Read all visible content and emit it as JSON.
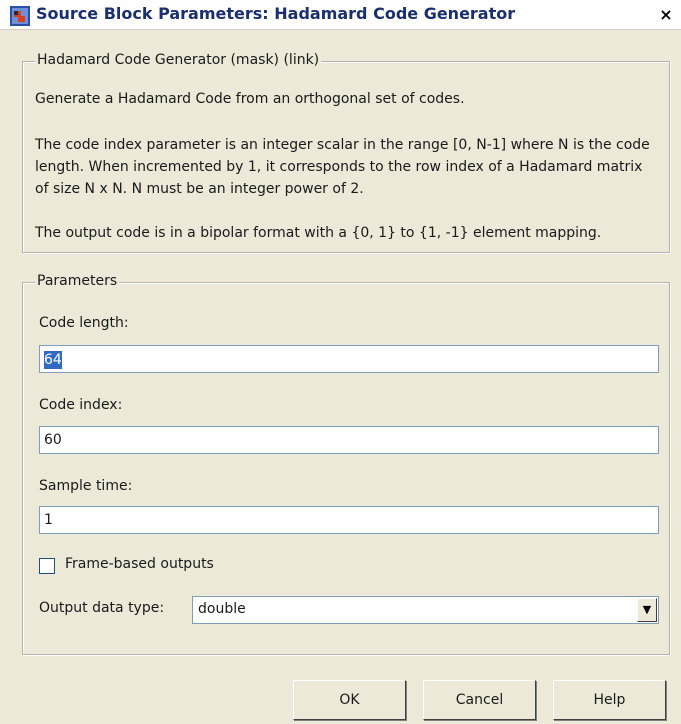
{
  "window": {
    "title": "Source Block Parameters: Hadamard Code Generator",
    "close_glyph": "×",
    "icon": "simulink-block-icon"
  },
  "description": {
    "group_title": "Hadamard Code Generator (mask) (link)",
    "paragraph_1": "Generate a Hadamard Code from an orthogonal set of codes.",
    "paragraph_2": "The code index parameter is an integer scalar in the range [0, N-1] where N is the code length.  When incremented by 1, it corresponds to the row index of a Hadamard matrix of size N x N. N must be an integer power of 2.",
    "paragraph_3": "The output code is in a bipolar format with a {0, 1} to {1, -1} element mapping."
  },
  "parameters": {
    "group_title": "Parameters",
    "code_length": {
      "label": "Code length:",
      "value": "64",
      "selected": true
    },
    "code_index": {
      "label": "Code index:",
      "value": "60"
    },
    "sample_time": {
      "label": "Sample time:",
      "value": "1"
    },
    "frame_based": {
      "label": "Frame-based outputs",
      "checked": false
    },
    "output_data_type": {
      "label": "Output data type:",
      "value": "double",
      "arrow": "▼"
    }
  },
  "buttons": {
    "ok": "OK",
    "cancel": "Cancel",
    "help": "Help"
  },
  "colors": {
    "dialog_bg": "#ece9d8",
    "title_text": "#1a2f70",
    "selection": "#316ac5",
    "input_border": "#7f9db9"
  }
}
